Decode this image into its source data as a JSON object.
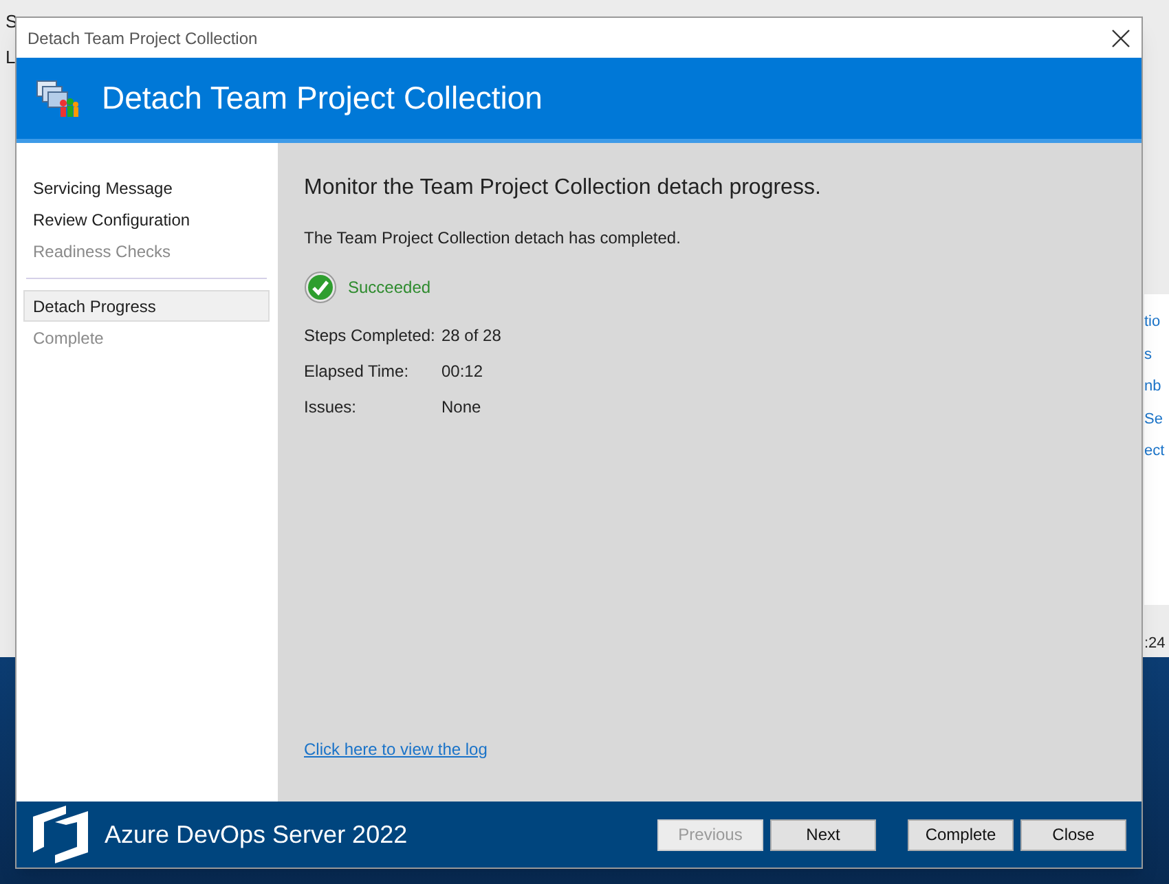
{
  "background": {
    "fragments_left": [
      "S",
      "L"
    ],
    "links_right": [
      "tio",
      "s",
      "nb",
      "Se",
      "ect"
    ],
    "status_text": ":24"
  },
  "window": {
    "title": "Detach Team Project Collection",
    "header": "Detach Team Project Collection"
  },
  "steps": [
    {
      "kind": "step",
      "label": "Servicing Message",
      "enabled": true,
      "selected": false
    },
    {
      "kind": "step",
      "label": "Review Configuration",
      "enabled": true,
      "selected": false
    },
    {
      "kind": "step",
      "label": "Readiness Checks",
      "enabled": false,
      "selected": false
    },
    {
      "kind": "separator"
    },
    {
      "kind": "step",
      "label": "Detach Progress",
      "enabled": true,
      "selected": true
    },
    {
      "kind": "step",
      "label": "Complete",
      "enabled": false,
      "selected": false
    }
  ],
  "content": {
    "heading": "Monitor the Team Project Collection detach progress.",
    "message": "The Team Project Collection detach has completed.",
    "status": {
      "succeeded": true,
      "text": "Succeeded"
    },
    "details": [
      {
        "label": "Steps Completed:",
        "value": "28 of 28"
      },
      {
        "label": "Elapsed Time:",
        "value": "00:12"
      },
      {
        "label": "Issues:",
        "value": "None"
      }
    ],
    "log_link": "Click here to view the log"
  },
  "footer": {
    "product": "Azure DevOps Server 2022",
    "buttons": [
      {
        "label": "Previous",
        "disabled": true
      },
      {
        "label": "Next",
        "disabled": false
      },
      {
        "label": "Complete",
        "disabled": false,
        "group_start": true
      },
      {
        "label": "Close",
        "disabled": false
      }
    ]
  }
}
